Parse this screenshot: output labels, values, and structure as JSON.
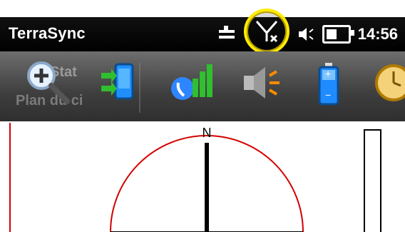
{
  "app": {
    "title": "TerraSync"
  },
  "status": {
    "time": "14:56"
  },
  "toolbar": {
    "ghost_text_1": "Stat",
    "ghost_text_2": "Plan du ci",
    "tools": [
      {
        "name": "zoom-in",
        "icon": "zoom-in-icon"
      },
      {
        "name": "connect-device",
        "icon": "device-transfer-icon"
      },
      {
        "name": "phone-signal",
        "icon": "phone-signal-icon"
      },
      {
        "name": "audio",
        "icon": "speaker-icon"
      },
      {
        "name": "battery",
        "icon": "battery-icon"
      },
      {
        "name": "clock",
        "icon": "clock-icon"
      }
    ]
  },
  "compass": {
    "north_label": "N"
  },
  "colors": {
    "titlebar": "#000000",
    "highlight": "#ffeb00",
    "compass_arc": "#d40000",
    "toolbar": "#4a4a4a"
  }
}
